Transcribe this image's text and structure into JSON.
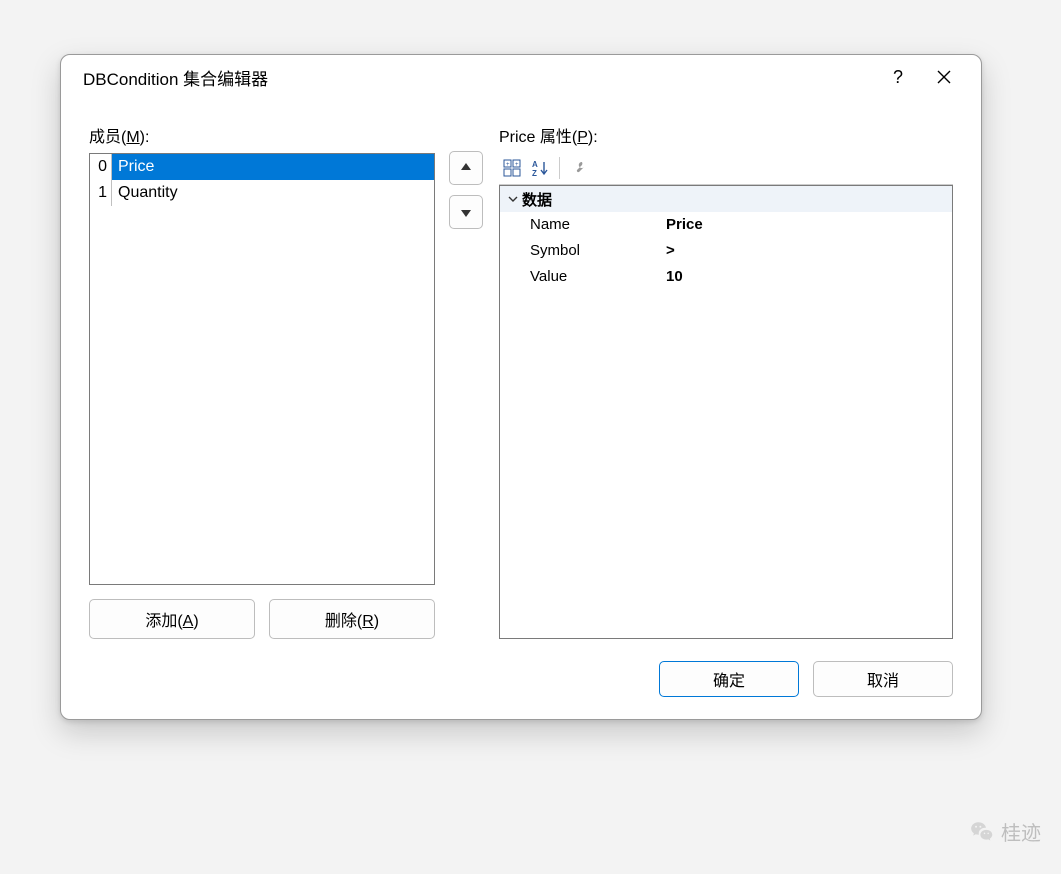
{
  "dialog": {
    "title": "DBCondition 集合编辑器",
    "help_tip": "?",
    "close_tip": "✕"
  },
  "members": {
    "label_prefix": "成员(",
    "label_key": "M",
    "label_suffix": "):",
    "items": [
      {
        "index": "0",
        "name": "Price",
        "selected": true
      },
      {
        "index": "1",
        "name": "Quantity",
        "selected": false
      }
    ],
    "add_label": "添加(A)",
    "remove_label": "删除(R)"
  },
  "properties": {
    "label_prefix": "Price 属性(",
    "label_key": "P",
    "label_suffix": "):",
    "category": "数据",
    "rows": [
      {
        "name": "Name",
        "value": "Price"
      },
      {
        "name": "Symbol",
        "value": ">"
      },
      {
        "name": "Value",
        "value": "10"
      }
    ]
  },
  "toolbar": {
    "categorized_icon": "categorized-icon",
    "alpha_icon": "sort-az-icon",
    "wrench_icon": "wrench-icon"
  },
  "footer": {
    "ok": "确定",
    "cancel": "取消"
  },
  "watermark": "桂迹"
}
